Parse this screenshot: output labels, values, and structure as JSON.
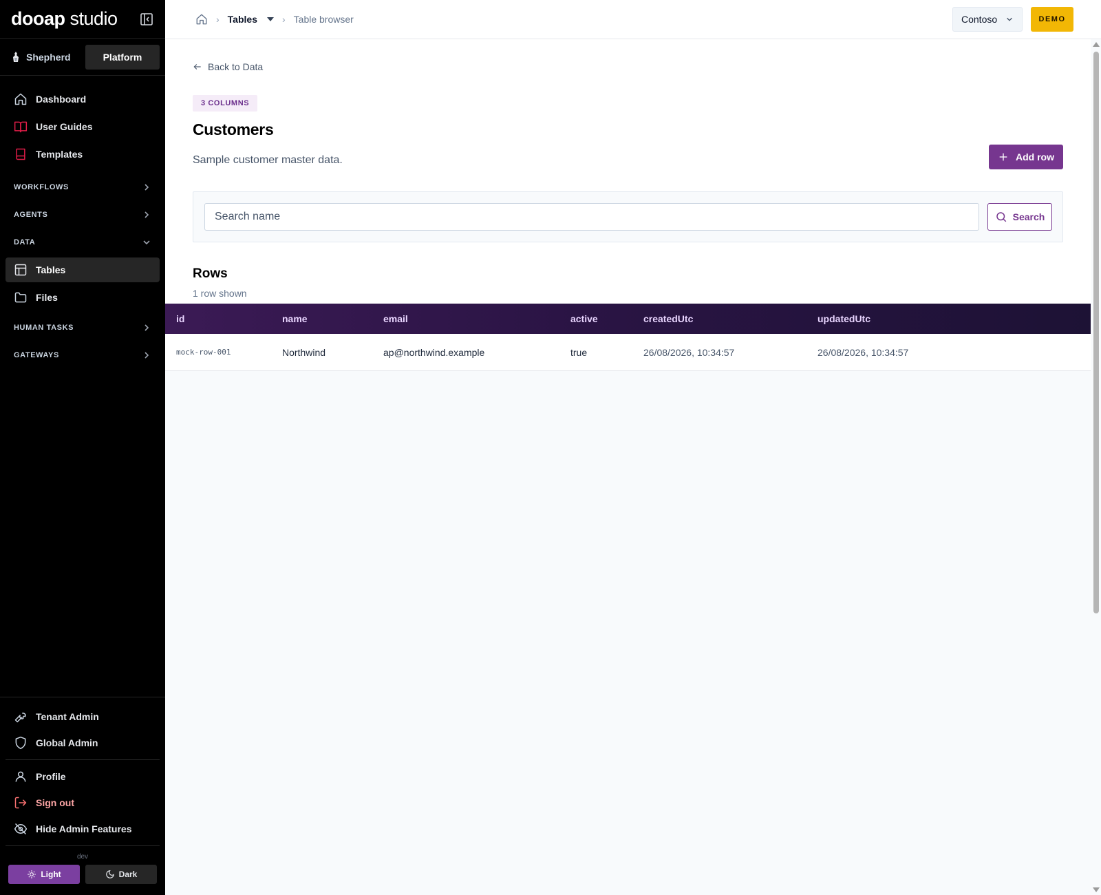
{
  "brand": {
    "bold": "dooap",
    "light": "studio"
  },
  "modes": {
    "shepherd": "Shepherd",
    "platform": "Platform"
  },
  "nav": {
    "dashboard": "Dashboard",
    "user_guides": "User Guides",
    "templates": "Templates",
    "workflows": "WORKFLOWS",
    "agents": "AGENTS",
    "data": "DATA",
    "tables": "Tables",
    "files": "Files",
    "human_tasks": "HUMAN TASKS",
    "gateways": "GATEWAYS"
  },
  "bottom_nav": {
    "tenant_admin": "Tenant Admin",
    "global_admin": "Global Admin",
    "profile": "Profile",
    "sign_out": "Sign out",
    "hide_admin": "Hide Admin Features",
    "env": "dev",
    "light": "Light",
    "dark": "Dark"
  },
  "breadcrumb": {
    "tables": "Tables",
    "current": "Table browser"
  },
  "tenant": "Contoso",
  "demo_badge": "DEMO",
  "page": {
    "back_link": "Back to Data",
    "columns_badge": "3 COLUMNS",
    "title": "Customers",
    "description": "Sample customer master data.",
    "add_row": "Add row"
  },
  "search": {
    "placeholder": "Search name",
    "button": "Search"
  },
  "rows": {
    "title": "Rows",
    "count": "1 row shown",
    "columns": [
      "id",
      "name",
      "email",
      "active",
      "createdUtc",
      "updatedUtc"
    ],
    "data": [
      {
        "id": "mock-row-001",
        "name": "Northwind",
        "email": "ap@northwind.example",
        "active": "true",
        "createdUtc": "26/08/2026, 10:34:57",
        "updatedUtc": "26/08/2026, 10:34:57"
      }
    ]
  },
  "colors": {
    "accent": "#76368f",
    "demo": "#f2b705",
    "sidebar": "#000000"
  }
}
